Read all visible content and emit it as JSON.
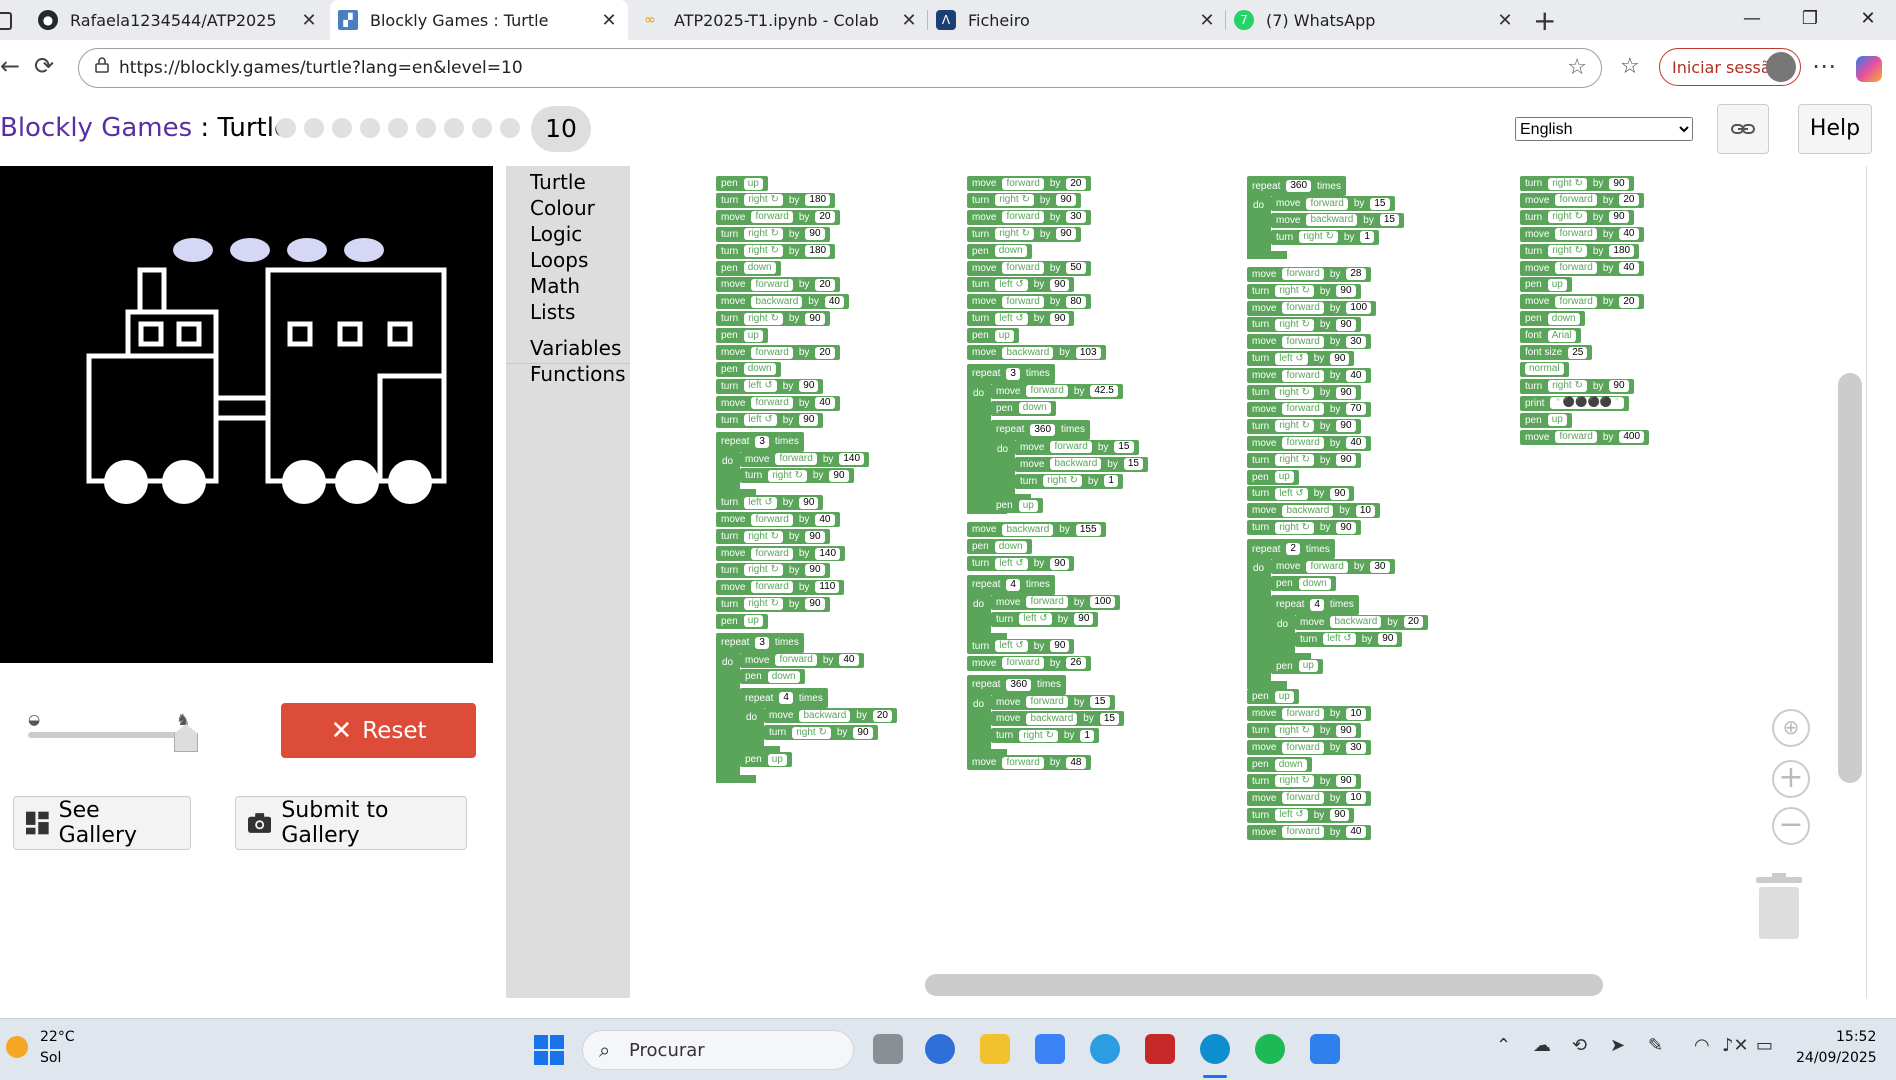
{
  "browser": {
    "tabs": [
      {
        "title": "Rafaela1234544/ATP2025",
        "icon": "github-icon"
      },
      {
        "title": "Blockly Games : Turtle",
        "icon": "blockly-icon"
      },
      {
        "title": "ATP2025-T1.ipynb - Colab",
        "icon": "colab-icon"
      },
      {
        "title": "Ficheiro",
        "icon": "ficheiro-icon"
      },
      {
        "title": "(7) WhatsApp",
        "icon": "whatsapp-icon",
        "badge": "7"
      }
    ],
    "url": "https://blockly.games/turtle?lang=en&level=10",
    "signin_label": "Iniciar sessão"
  },
  "page": {
    "title_app": "Blockly Games",
    "title_sep": " : ",
    "title_game": "Turtle",
    "level": "10",
    "language": "English",
    "help_label": "Help",
    "reset_label": "Reset",
    "gallery_label": "See Gallery",
    "submit_label": "Submit to Gallery"
  },
  "toolbox": [
    "Turtle",
    "Colour",
    "Logic",
    "Loops",
    "Math",
    "Lists",
    "Variables",
    "Functions"
  ],
  "blocks": {
    "col1": [
      [
        "pen",
        "up"
      ],
      [
        "turn",
        "right ↻",
        "by",
        "180"
      ],
      [
        "move",
        "forward",
        "by",
        "20"
      ],
      [
        "turn",
        "right ↻",
        "by",
        "90"
      ],
      [
        "turn",
        "right ↻",
        "by",
        "180"
      ],
      [
        "pen",
        "down"
      ],
      [
        "move",
        "forward",
        "by",
        "20"
      ],
      [
        "move",
        "backward",
        "by",
        "40"
      ],
      [
        "turn",
        "right ↻",
        "by",
        "90"
      ],
      [
        "pen",
        "up"
      ],
      [
        "move",
        "forward",
        "by",
        "20"
      ],
      [
        "pen",
        "down"
      ],
      [
        "turn",
        "left ↺",
        "by",
        "90"
      ],
      [
        "move",
        "forward",
        "by",
        "40"
      ],
      [
        "turn",
        "left ↺",
        "by",
        "90"
      ]
    ],
    "col1_repeat1": {
      "count": "3",
      "body": [
        [
          "move",
          "forward",
          "by",
          "140"
        ],
        [
          "turn",
          "right ↻",
          "by",
          "90"
        ]
      ]
    },
    "col1_b": [
      [
        "turn",
        "left ↺",
        "by",
        "90"
      ],
      [
        "move",
        "forward",
        "by",
        "40"
      ],
      [
        "turn",
        "right ↻",
        "by",
        "90"
      ],
      [
        "move",
        "forward",
        "by",
        "140"
      ],
      [
        "turn",
        "right ↻",
        "by",
        "90"
      ],
      [
        "move",
        "forward",
        "by",
        "110"
      ],
      [
        "turn",
        "right ↻",
        "by",
        "90"
      ],
      [
        "pen",
        "up"
      ]
    ],
    "col1_repeat2": {
      "count": "3",
      "body1": [
        [
          "move",
          "forward",
          "by",
          "40"
        ],
        [
          "pen",
          "down"
        ]
      ],
      "inner_count": "4",
      "inner": [
        [
          "move",
          "backward",
          "by",
          "20"
        ],
        [
          "turn",
          "right ↻",
          "by",
          "90"
        ]
      ],
      "tail": [
        [
          "pen",
          "up"
        ]
      ]
    },
    "col2": [
      [
        "move",
        "forward",
        "by",
        "20"
      ],
      [
        "turn",
        "right ↻",
        "by",
        "90"
      ],
      [
        "move",
        "forward",
        "by",
        "30"
      ],
      [
        "turn",
        "right ↻",
        "by",
        "90"
      ],
      [
        "pen",
        "down"
      ],
      [
        "move",
        "forward",
        "by",
        "50"
      ],
      [
        "turn",
        "left ↺",
        "by",
        "90"
      ],
      [
        "move",
        "forward",
        "by",
        "80"
      ],
      [
        "turn",
        "left ↺",
        "by",
        "90"
      ],
      [
        "pen",
        "up"
      ],
      [
        "move",
        "backward",
        "by",
        "103"
      ]
    ],
    "col2_repeat1": {
      "count": "3",
      "body": [
        [
          "move",
          "forward",
          "by",
          "42.5"
        ],
        [
          "pen",
          "down"
        ]
      ],
      "inner_count": "360",
      "inner": [
        [
          "move",
          "forward",
          "by",
          "15"
        ],
        [
          "move",
          "backward",
          "by",
          "15"
        ],
        [
          "turn",
          "right ↻",
          "by",
          "1"
        ]
      ],
      "tail": [
        [
          "pen",
          "up"
        ]
      ]
    },
    "col2_b": [
      [
        "move",
        "backward",
        "by",
        "155"
      ],
      [
        "pen",
        "down"
      ],
      [
        "turn",
        "left ↺",
        "by",
        "90"
      ]
    ],
    "col2_repeat2": {
      "count": "4",
      "body": [
        [
          "move",
          "forward",
          "by",
          "100"
        ],
        [
          "turn",
          "left ↺",
          "by",
          "90"
        ]
      ]
    },
    "col2_c": [
      [
        "turn",
        "left ↺",
        "by",
        "90"
      ],
      [
        "move",
        "forward",
        "by",
        "26"
      ]
    ],
    "col2_repeat3": {
      "count": "360",
      "body": [
        [
          "move",
          "forward",
          "by",
          "15"
        ],
        [
          "move",
          "backward",
          "by",
          "15"
        ],
        [
          "turn",
          "right ↻",
          "by",
          "1"
        ]
      ]
    },
    "col2_d": [
      [
        "move",
        "forward",
        "by",
        "48"
      ]
    ],
    "col3_repeat1": {
      "count": "360",
      "body": [
        [
          "move",
          "forward",
          "by",
          "15"
        ],
        [
          "move",
          "backward",
          "by",
          "15"
        ],
        [
          "turn",
          "right ↻",
          "by",
          "1"
        ]
      ]
    },
    "col3": [
      [
        "move",
        "forward",
        "by",
        "28"
      ],
      [
        "turn",
        "right ↻",
        "by",
        "90"
      ],
      [
        "move",
        "forward",
        "by",
        "100"
      ],
      [
        "turn",
        "right ↻",
        "by",
        "90"
      ],
      [
        "move",
        "forward",
        "by",
        "30"
      ],
      [
        "turn",
        "left ↺",
        "by",
        "90"
      ],
      [
        "move",
        "forward",
        "by",
        "40"
      ],
      [
        "turn",
        "right ↻",
        "by",
        "90"
      ],
      [
        "move",
        "forward",
        "by",
        "70"
      ],
      [
        "turn",
        "right ↻",
        "by",
        "90"
      ],
      [
        "move",
        "forward",
        "by",
        "40"
      ],
      [
        "turn",
        "right ↻",
        "by",
        "90"
      ],
      [
        "pen",
        "up"
      ],
      [
        "turn",
        "left ↺",
        "by",
        "90"
      ],
      [
        "move",
        "backward",
        "by",
        "10"
      ],
      [
        "turn",
        "right ↻",
        "by",
        "90"
      ]
    ],
    "col3_repeat2": {
      "count": "2",
      "body": [
        [
          "move",
          "forward",
          "by",
          "30"
        ],
        [
          "pen",
          "down"
        ]
      ],
      "inner_count": "4",
      "inner": [
        [
          "move",
          "backward",
          "by",
          "20"
        ],
        [
          "turn",
          "left ↺",
          "by",
          "90"
        ]
      ],
      "tail": [
        [
          "pen",
          "up"
        ]
      ]
    },
    "col3_b": [
      [
        "pen",
        "up"
      ],
      [
        "move",
        "forward",
        "by",
        "10"
      ],
      [
        "turn",
        "right ↻",
        "by",
        "90"
      ],
      [
        "move",
        "forward",
        "by",
        "30"
      ],
      [
        "pen",
        "down"
      ],
      [
        "turn",
        "right ↻",
        "by",
        "90"
      ],
      [
        "move",
        "forward",
        "by",
        "10"
      ],
      [
        "turn",
        "left ↺",
        "by",
        "90"
      ],
      [
        "move",
        "forward",
        "by",
        "40"
      ]
    ],
    "col4": [
      [
        "turn",
        "right ↻",
        "by",
        "90"
      ],
      [
        "move",
        "forward",
        "by",
        "20"
      ],
      [
        "turn",
        "right ↻",
        "by",
        "90"
      ],
      [
        "move",
        "forward",
        "by",
        "40"
      ],
      [
        "turn",
        "right ↻",
        "by",
        "180"
      ],
      [
        "move",
        "forward",
        "by",
        "40"
      ],
      [
        "pen",
        "up"
      ],
      [
        "move",
        "forward",
        "by",
        "20"
      ],
      [
        "pen",
        "down"
      ],
      [
        "font",
        "Arial"
      ],
      [
        "font size",
        "25"
      ],
      [
        "normal"
      ],
      [
        "turn",
        "right ↻",
        "by",
        "90"
      ],
      [
        "print",
        "“ ⚫⚫⚫⚫ ”"
      ],
      [
        "pen",
        "up"
      ],
      [
        "move",
        "forward",
        "by",
        "400"
      ]
    ]
  },
  "taskbar": {
    "weather_temp": "22°C",
    "weather_desc": "Sol",
    "search_label": "Procurar",
    "time": "15:52",
    "date": "24/09/2025"
  }
}
